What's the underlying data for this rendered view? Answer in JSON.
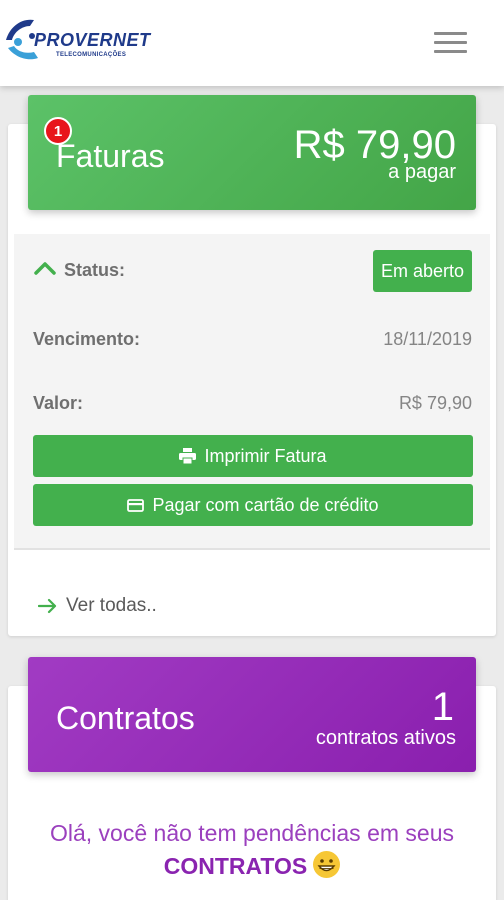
{
  "header": {
    "brand": "PROVERNET",
    "brand_sub": "TELECOMUNICAÇÕES",
    "menu_icon": "hamburger-menu-icon"
  },
  "faturas": {
    "title": "Faturas",
    "badge_count": "1",
    "amount": "R$ 79,90",
    "amount_caption": "a pagar",
    "color": "#4caf50",
    "status_label": "Status:",
    "status_value": "Em aberto",
    "due_label": "Vencimento:",
    "due_value": "18/11/2019",
    "value_label": "Valor:",
    "value_value": "R$ 79,90",
    "print_button": "Imprimir Fatura",
    "pay_button": "Pagar com cartão de crédito",
    "see_all": "Ver todas.."
  },
  "contratos": {
    "title": "Contratos",
    "count": "1",
    "count_caption": "contratos ativos",
    "color": "#9c27b0",
    "message": "Olá, você não tem pendências em seus",
    "message_strong": "CONTRATOS"
  }
}
